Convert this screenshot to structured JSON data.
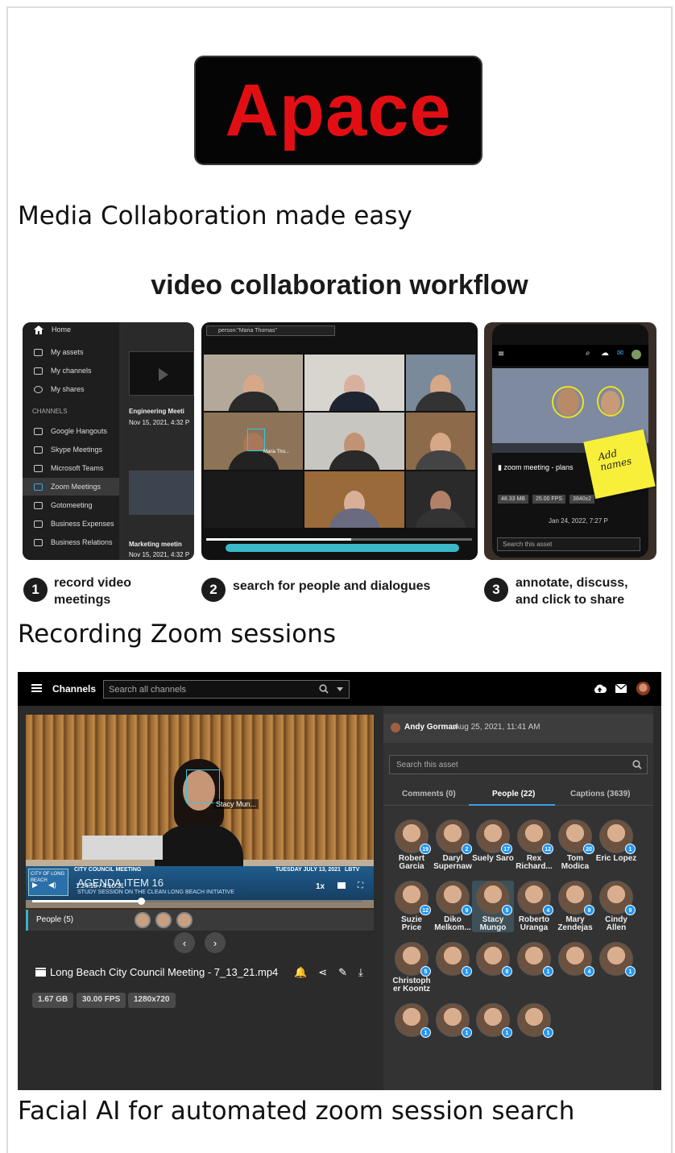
{
  "brand": {
    "logo_text": "Apace",
    "logo_color": "#e10f14"
  },
  "captions": {
    "tagline": "Media Collaboration made easy",
    "recording": "Recording Zoom sessions",
    "facial_ai": "Facial AI for automated zoom session search"
  },
  "workflow": {
    "title": "video collaboration workflow",
    "nav": {
      "home": "Home",
      "my_assets": "My assets",
      "my_channels": "My channels",
      "my_shares": "My shares",
      "channels_header": "CHANNELS",
      "channels": [
        "Google Hangouts",
        "Skype Meetings",
        "Microsoft Teams",
        "Zoom Meetings",
        "Gotomeeting",
        "Business Expenses",
        "Business Relations"
      ],
      "thumb1_title": "Engineering Meeti",
      "thumb1_date": "Nov 15, 2021, 4:32 P",
      "thumb2_title": "Marketing meetin",
      "thumb2_date": "Nov 15, 2021, 4:32 P"
    },
    "search_panel": {
      "query": "person:\"Maria Thomas\"",
      "face_label": "Maria Tho..."
    },
    "mobile_panel": {
      "asset_title": "zoom meeting - plans",
      "chips": [
        "48.33 MB",
        "25.00 FPS",
        "3840x2"
      ],
      "date": "Jan 24, 2022, 7:27 P",
      "search_placeholder": "Search this asset",
      "sticky_note": "Add names"
    },
    "steps": [
      {
        "num": "1",
        "text": "record video meetings"
      },
      {
        "num": "2",
        "text": "search for people and dialogues"
      },
      {
        "num": "3",
        "text": "annotate, discuss, and click to share"
      }
    ]
  },
  "app": {
    "topbar": {
      "channels_label": "Channels",
      "search_placeholder": "Search all channels"
    },
    "player": {
      "face_label": "Stacy Mun...",
      "lower_third": {
        "org": "CITY OF LONG BEACH",
        "program": "CITY COUNCIL MEETING",
        "date": "TUESDAY JULY 13, 2021",
        "channel": "LBTV",
        "agenda": "AGENDA ITEM 16",
        "study": "STUDY SESSION ON THE CLEAN LONG BEACH INITIATIVE"
      },
      "time_current": "1:24:10",
      "time_sep": "/",
      "time_total": "4:10:31",
      "speed": "1x",
      "progress": 0.33,
      "people_label": "People (5)"
    },
    "asset": {
      "title": "Long Beach City Council Meeting - 7_13_21.mp4",
      "chips": [
        "1.67 GB",
        "30.00 FPS",
        "1280x720"
      ]
    },
    "comments_panel": {
      "owner": "Andy Gorman",
      "date": "Aug 25, 2021, 11:41 AM",
      "search_placeholder": "Search this asset",
      "tabs": [
        "Comments (0)",
        "People (22)",
        "Captions (3639)"
      ],
      "active_tab": 1
    },
    "people": [
      {
        "name": "Robert Garcia",
        "count": "19"
      },
      {
        "name": "Daryl Supernaw",
        "count": "2"
      },
      {
        "name": "Suely Saro",
        "count": "17"
      },
      {
        "name": "Rex Richard...",
        "count": "12"
      },
      {
        "name": "Tom Modica",
        "count": "20"
      },
      {
        "name": "Eric Lopez",
        "count": "1"
      },
      {
        "name": "Suzie Price",
        "count": "12"
      },
      {
        "name": "Diko Melkom...",
        "count": "9"
      },
      {
        "name": "Stacy Mungo",
        "count": "5"
      },
      {
        "name": "Roberto Uranga",
        "count": "4"
      },
      {
        "name": "Mary Zendejas",
        "count": "9"
      },
      {
        "name": "Cindy Allen",
        "count": "9"
      },
      {
        "name": "Christoph er Koontz",
        "count": "5"
      },
      {
        "name": "",
        "count": "1"
      },
      {
        "name": "",
        "count": "8"
      },
      {
        "name": "",
        "count": "1"
      },
      {
        "name": "",
        "count": "4"
      },
      {
        "name": "",
        "count": "1"
      },
      {
        "name": "",
        "count": "1"
      },
      {
        "name": "",
        "count": "1"
      },
      {
        "name": "",
        "count": "1"
      },
      {
        "name": "",
        "count": "1"
      }
    ],
    "accent": "#2196f3"
  }
}
